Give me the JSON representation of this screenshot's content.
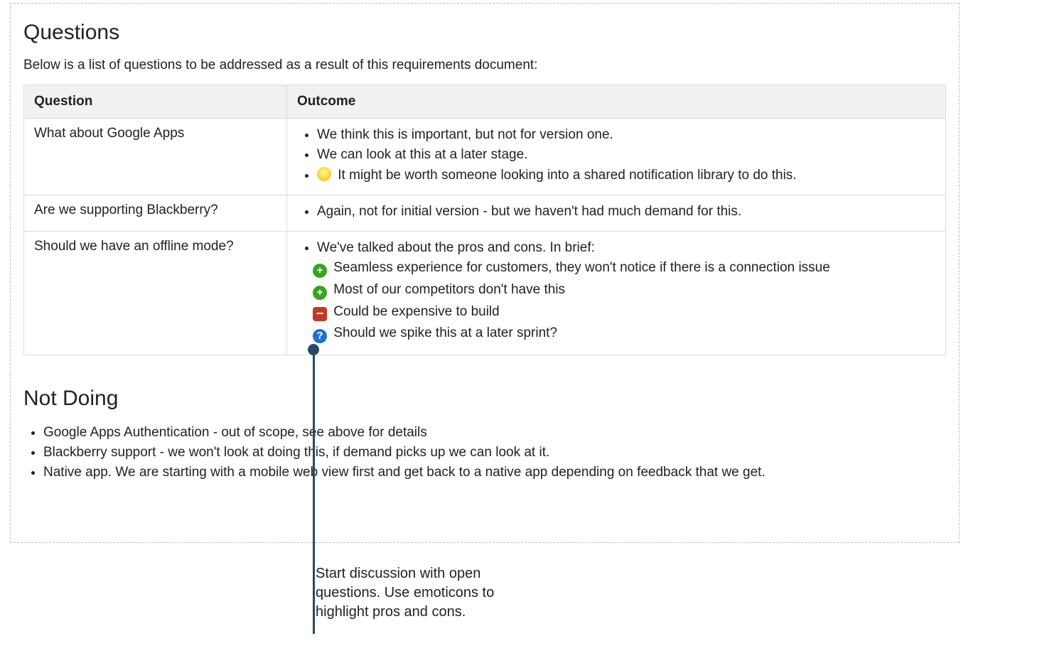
{
  "questions": {
    "heading": "Questions",
    "intro": "Below is a list of questions to be addressed as a result of this requirements document:",
    "columns": {
      "question": "Question",
      "outcome": "Outcome"
    },
    "rows": [
      {
        "question": "What about Google Apps",
        "outcome": [
          {
            "type": "bullet",
            "text": "We think this is important, but not for version one."
          },
          {
            "type": "bullet",
            "text": "We can look at this at a later stage."
          },
          {
            "type": "bulb",
            "text": "It might be worth someone looking into a shared notification library to do this."
          }
        ]
      },
      {
        "question": "Are we supporting Blackberry?",
        "outcome": [
          {
            "type": "bullet",
            "text": "Again, not for initial version - but we haven't had much demand for this."
          }
        ]
      },
      {
        "question": "Should we have an offline mode?",
        "outcome": [
          {
            "type": "bullet",
            "text": "We've talked about the pros and cons. In brief:"
          },
          {
            "type": "plus",
            "text": "Seamless experience for customers, they won't notice if there is a connection issue"
          },
          {
            "type": "plus",
            "text": "Most of our competitors don't have this"
          },
          {
            "type": "minus",
            "text": "Could be expensive to build"
          },
          {
            "type": "question",
            "text": "Should we spike this at a later sprint?"
          }
        ]
      }
    ]
  },
  "not_doing": {
    "heading": "Not Doing",
    "items": [
      "Google Apps Authentication - out of scope, see above for details",
      "Blackberry support - we won't look at doing this, if demand picks up we can look at it.",
      "Native app. We are starting with a mobile web view first and get back to a native app depending on feedback that we get."
    ]
  },
  "callout": {
    "text": "Start discussion with open questions. Use emoticons to highlight pros and cons."
  }
}
